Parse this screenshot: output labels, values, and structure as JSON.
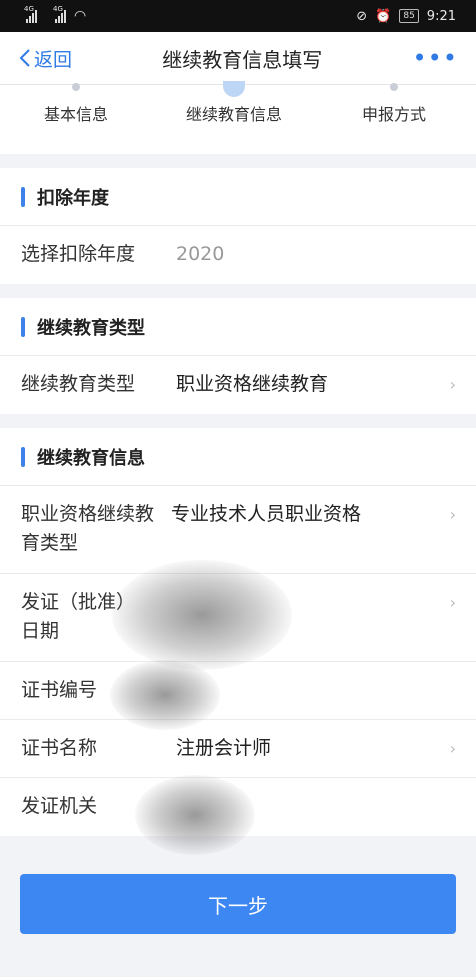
{
  "status_bar": {
    "net1": "4G",
    "net2": "4G",
    "battery": "85",
    "time": "9:21"
  },
  "nav": {
    "back_label": "返回",
    "title": "继续教育信息填写",
    "more": "•••"
  },
  "steps": [
    {
      "label": "基本信息",
      "active": false
    },
    {
      "label": "继续教育信息",
      "active": true
    },
    {
      "label": "申报方式",
      "active": false
    }
  ],
  "deduction_year": {
    "title": "扣除年度",
    "row": {
      "label": "选择扣除年度",
      "value": "2020"
    }
  },
  "education_type": {
    "title": "继续教育类型",
    "row": {
      "label": "继续教育类型",
      "value": "职业资格继续教育"
    }
  },
  "education_info": {
    "title": "继续教育信息",
    "rows": [
      {
        "label": "职业资格继续教育类型",
        "value": "专业技术人员职业资格"
      },
      {
        "label": "发证（批准）日期",
        "value": ""
      },
      {
        "label": "证书编号",
        "value": ""
      },
      {
        "label": "证书名称",
        "value": "注册会计师"
      },
      {
        "label": "发证机关",
        "value": ""
      }
    ]
  },
  "next_button": "下一步"
}
